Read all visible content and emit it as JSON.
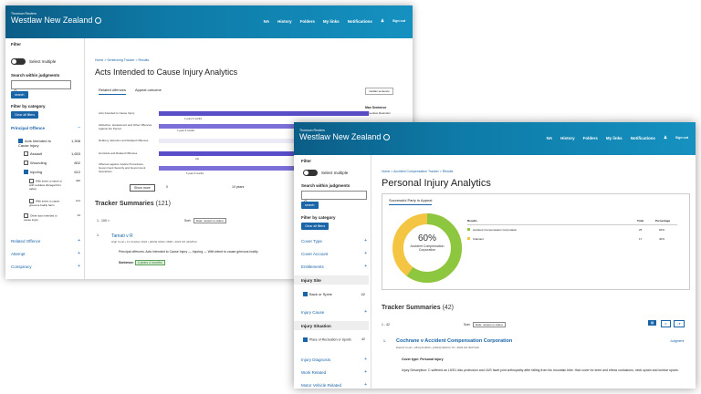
{
  "shot1": {
    "header": {
      "brand_small": "Thomson Reuters",
      "brand": "Westlaw New Zealand",
      "nav": [
        "NA",
        "History",
        "Folders",
        "My links",
        "Notifications",
        "Sign out"
      ]
    },
    "sidebar": {
      "filter": "Filter",
      "select_multiple": "Select multiple",
      "search_label": "Search within judgments",
      "search_btn": "search",
      "filter_by": "Filter by category",
      "clear_all": "Clear all filters",
      "principal": "Principal Offence",
      "items": [
        {
          "label": "Acts Intended to Cause Injury",
          "count": "1,308"
        },
        {
          "label": "Assault",
          "count": "1,653"
        },
        {
          "label": "Wounding",
          "count": "802"
        },
        {
          "label": "Injuring",
          "count": "612"
        },
        {
          "label": "With intent to injure or with reckless disregard for safety",
          "count": "440"
        },
        {
          "label": "With intent to cause grievous bodily harm",
          "count": "121"
        },
        {
          "label": "Other acts intended to cause injury",
          "count": "34"
        }
      ],
      "sections": [
        "Related Offence",
        "Attempt",
        "Conspiracy"
      ]
    },
    "main": {
      "crumb": "Home > Sentencing Tracker > Results",
      "title": "Acts Intended to Cause Injury Analytics",
      "tabs": [
        "Related offences",
        "Appeal outcome"
      ],
      "dropdown": "median sentence",
      "max_sentence": "Max Sentence",
      "prev_det": "Preventive Detention",
      "chart_rows": [
        {
          "label": "Acts Intended to Cause Injury",
          "tip": "4 years 6 months"
        },
        {
          "label": "Abduction, Harassment and Other Offences Against the Person",
          "tip": "3 years 6 months"
        },
        {
          "label": "Robbery, Extortion and Related Offences",
          "tip": ""
        },
        {
          "label": "Homicide and Related Offences",
          "tip": "Life"
        },
        {
          "label": "Offences against Justice Procedures, Government Security and Government Operations",
          "tip": "5 years 6 months"
        }
      ],
      "show_more": "Show more",
      "axis": [
        "0",
        "10 years",
        "20"
      ],
      "tracker": "Tracker Summaries",
      "tracker_count": "(121)",
      "pagination": "1 - 100 >",
      "sort_label": "Sort:",
      "sort_value": "Date: newest to oldest",
      "case": {
        "num": "1.",
        "name": "Tamati v R",
        "meta": "High Court  •  11 October 2024  •  [2024] NZHC 2848  •  2024 NZ 4432513",
        "offences": "Principal offences: Acts Intended to Cause Injury — Injuring — With intent to cause grievous bodily",
        "sentence_label": "Sentence:",
        "sentence": "4 years 4 months"
      }
    }
  },
  "shot2": {
    "header": {
      "brand_small": "Thomson Reuters",
      "brand": "Westlaw New Zealand",
      "nav": [
        "NA",
        "History",
        "Folders",
        "My links",
        "Notifications",
        "Sign out"
      ]
    },
    "sidebar": {
      "filter": "Filter",
      "select_multiple": "Select multiple",
      "search_label": "Search within judgments",
      "search_btn": "search",
      "filter_by": "Filter by category",
      "clear_all": "Clear all filters",
      "cats": [
        "Cover Type",
        "Cover Account",
        "Entitlements",
        "Injury Site"
      ],
      "site_item": {
        "label": "Back or Spine",
        "count": "42"
      },
      "cats2": [
        "Injury Cause",
        "Injury Situation"
      ],
      "situation_item": {
        "label": "Place of Recreation or Sports",
        "count": "42"
      },
      "cats3": [
        "Injury Diagnosis",
        "Work Related",
        "Motor Vehicle Related"
      ]
    },
    "main": {
      "crumb": "Home > Accident Compensation Tracker > Results",
      "title": "Personal Injury Analytics",
      "tab": "Successful Party in Appeal",
      "donut_pct": "60%",
      "donut_lbl": "Accident Compensation Corporation",
      "table_head": [
        "Results",
        "Total",
        "Percentage"
      ],
      "table_rows": [
        {
          "label": "Accident Compensation Corporation",
          "total": "25",
          "pct": "60%",
          "color": "#8dc63f"
        },
        {
          "label": "Claimant",
          "total": "17",
          "pct": "40%",
          "color": "#f4c542"
        }
      ],
      "tracker": "Tracker Summaries",
      "tracker_count": "(42)",
      "pagination": "1 - 42",
      "sort_label": "Sort:",
      "sort_value": "Date: newest to oldest",
      "case": {
        "num": "1.",
        "name": "Cochrane v Accident Compensation Corporation",
        "tag": "Judgment",
        "meta": "District Court  •  28 April 2024  •  [2024] NZACC 76  •  2024 NZ 3027129",
        "cover": "Cover type: Personal injury",
        "injury": "Injury Description: C suffered an L5/S1 disc protrusion and L5/S facet joint arthropathy after falling from his mountain bike. Had cover for knee and elbow contusions, neck sprain and lumbar sprain."
      }
    }
  }
}
